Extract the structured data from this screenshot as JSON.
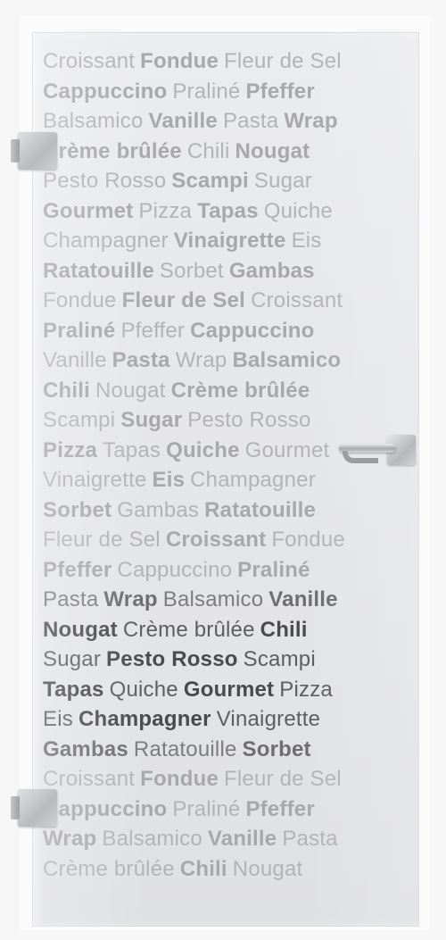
{
  "glass_door": {
    "lines": [
      {
        "words": [
          {
            "t": "Croissant",
            "b": false
          },
          {
            "t": "Fondue",
            "b": true
          },
          {
            "t": "Fleur de Sel",
            "b": false
          }
        ]
      },
      {
        "words": [
          {
            "t": "Cappuccino",
            "b": true
          },
          {
            "t": "Praliné",
            "b": false
          },
          {
            "t": "Pfeffer",
            "b": true
          }
        ]
      },
      {
        "words": [
          {
            "t": "Balsamico",
            "b": false
          },
          {
            "t": "Vanille",
            "b": true
          },
          {
            "t": "Pasta",
            "b": false
          },
          {
            "t": "Wrap",
            "b": true
          }
        ]
      },
      {
        "words": [
          {
            "t": "Crème brûlée",
            "b": true
          },
          {
            "t": "Chili",
            "b": false
          },
          {
            "t": "Nougat",
            "b": true
          }
        ]
      },
      {
        "words": [
          {
            "t": "Pesto Rosso",
            "b": false
          },
          {
            "t": "Scampi",
            "b": true
          },
          {
            "t": "Sugar",
            "b": false
          }
        ]
      },
      {
        "words": [
          {
            "t": "Gourmet",
            "b": true
          },
          {
            "t": "Pizza",
            "b": false
          },
          {
            "t": "Tapas",
            "b": true
          },
          {
            "t": "Quiche",
            "b": false
          }
        ]
      },
      {
        "words": [
          {
            "t": "Champagner",
            "b": false
          },
          {
            "t": "Vinaigrette",
            "b": true
          },
          {
            "t": "Eis",
            "b": false
          }
        ]
      },
      {
        "words": [
          {
            "t": "Ratatouille",
            "b": true
          },
          {
            "t": "Sorbet",
            "b": false
          },
          {
            "t": "Gambas",
            "b": true
          }
        ]
      },
      {
        "words": [
          {
            "t": "Fondue",
            "b": false
          },
          {
            "t": "Fleur de Sel",
            "b": true
          },
          {
            "t": "Croissant",
            "b": false
          }
        ]
      },
      {
        "words": [
          {
            "t": "Praliné",
            "b": true
          },
          {
            "t": "Pfeffer",
            "b": false
          },
          {
            "t": "Cappuccino",
            "b": true
          }
        ]
      },
      {
        "words": [
          {
            "t": "Vanille",
            "b": false
          },
          {
            "t": "Pasta",
            "b": true
          },
          {
            "t": "Wrap",
            "b": false
          },
          {
            "t": "Balsamico",
            "b": true
          }
        ]
      },
      {
        "words": [
          {
            "t": "Chili",
            "b": true
          },
          {
            "t": "Nougat",
            "b": false
          },
          {
            "t": "Crème brûlée",
            "b": true
          }
        ]
      },
      {
        "words": [
          {
            "t": "Scampi",
            "b": false
          },
          {
            "t": "Sugar",
            "b": true
          },
          {
            "t": "Pesto Rosso",
            "b": false
          }
        ]
      },
      {
        "words": [
          {
            "t": "Pizza",
            "b": true
          },
          {
            "t": "Tapas",
            "b": false
          },
          {
            "t": "Quiche",
            "b": true
          },
          {
            "t": "Gourmet",
            "b": false
          }
        ]
      },
      {
        "words": [
          {
            "t": "Vinaigrette",
            "b": false
          },
          {
            "t": "Eis",
            "b": true
          },
          {
            "t": "Champagner",
            "b": false
          }
        ]
      },
      {
        "words": [
          {
            "t": "Sorbet",
            "b": true
          },
          {
            "t": "Gambas",
            "b": false
          },
          {
            "t": "Ratatouille",
            "b": true
          }
        ]
      },
      {
        "words": [
          {
            "t": "Fleur de Sel",
            "b": false
          },
          {
            "t": "Croissant",
            "b": true
          },
          {
            "t": "Fondue",
            "b": false
          }
        ]
      },
      {
        "words": [
          {
            "t": "Pfeffer",
            "b": true
          },
          {
            "t": "Cappuccino",
            "b": false
          },
          {
            "t": "Praliné",
            "b": true
          }
        ]
      },
      {
        "words": [
          {
            "t": "Pasta",
            "b": false
          },
          {
            "t": "Wrap",
            "b": true
          },
          {
            "t": "Balsamico",
            "b": false
          },
          {
            "t": "Vanille",
            "b": true
          }
        ]
      },
      {
        "words": [
          {
            "t": "Nougat",
            "b": true
          },
          {
            "t": "Crème brûlée",
            "b": false
          },
          {
            "t": "Chili",
            "b": true
          }
        ]
      },
      {
        "words": [
          {
            "t": "Sugar",
            "b": false
          },
          {
            "t": "Pesto Rosso",
            "b": true
          },
          {
            "t": "Scampi",
            "b": false
          }
        ]
      },
      {
        "words": [
          {
            "t": "Tapas",
            "b": true
          },
          {
            "t": "Quiche",
            "b": false
          },
          {
            "t": "Gourmet",
            "b": true
          },
          {
            "t": "Pizza",
            "b": false
          }
        ]
      },
      {
        "words": [
          {
            "t": "Eis",
            "b": false
          },
          {
            "t": "Champagner",
            "b": true
          },
          {
            "t": "Vinaigrette",
            "b": false
          }
        ]
      },
      {
        "words": [
          {
            "t": "Gambas",
            "b": true
          },
          {
            "t": "Ratatouille",
            "b": false
          },
          {
            "t": "Sorbet",
            "b": true
          }
        ]
      },
      {
        "words": [
          {
            "t": "Croissant",
            "b": false
          },
          {
            "t": "Fondue",
            "b": true
          },
          {
            "t": "Fleur de Sel",
            "b": false
          }
        ]
      },
      {
        "words": [
          {
            "t": "Cappuccino",
            "b": true
          },
          {
            "t": "Praliné",
            "b": false
          },
          {
            "t": "Pfeffer",
            "b": true
          }
        ]
      },
      {
        "words": [
          {
            "t": "Wrap",
            "b": true
          },
          {
            "t": "Balsamico",
            "b": false
          },
          {
            "t": "Vanille",
            "b": true
          },
          {
            "t": "Pasta",
            "b": false
          }
        ]
      },
      {
        "words": [
          {
            "t": "Crème brûlée",
            "b": false
          },
          {
            "t": "Chili",
            "b": true
          },
          {
            "t": "Nougat",
            "b": false
          }
        ]
      }
    ]
  },
  "colors": {
    "glass": "#e6e7ea",
    "frame": "#f7f7f7",
    "etched_text": "#b3b3b6",
    "hardware": "#b9babd"
  }
}
